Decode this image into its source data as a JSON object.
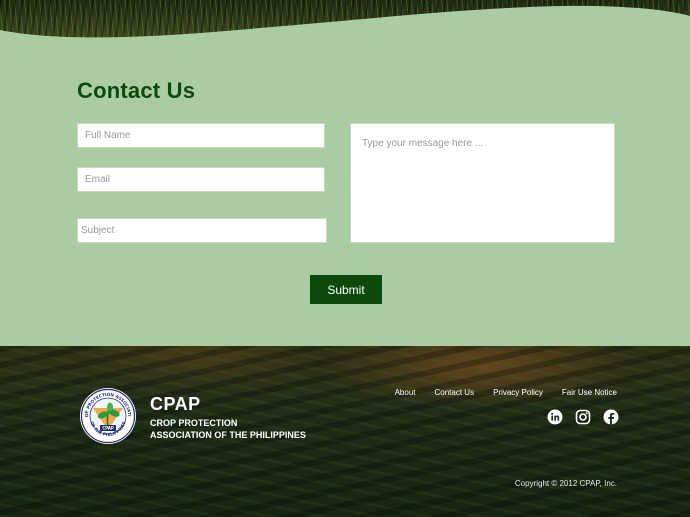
{
  "contact": {
    "title": "Contact Us",
    "full_name_placeholder": "Full Name",
    "email_placeholder": "Email",
    "subject_placeholder": "Subject",
    "message_placeholder": "Type your message here ...",
    "submit_label": "Submit"
  },
  "footer": {
    "logo": {
      "ring_text_top": "CROP PROTECTION ASSOCIATION",
      "ring_text_bottom": "OF THE PHILIPPINES",
      "center_text": "CPAP"
    },
    "brand_name": "CPAP",
    "brand_full_line1": "CROP PROTECTION",
    "brand_full_line2": "ASSOCIATION OF THE PHILIPPINES",
    "links": [
      "About",
      "Contact Us",
      "Privacy Policy",
      "Fair Use Notice"
    ],
    "social_icons": [
      "linkedin-icon",
      "instagram-icon",
      "facebook-icon"
    ],
    "copyright": "Copyright © 2012 CPAP, Inc."
  },
  "colors": {
    "section_bg": "#abcca3",
    "title": "#0d4a0f",
    "submit_bg": "#0c4a0c"
  }
}
